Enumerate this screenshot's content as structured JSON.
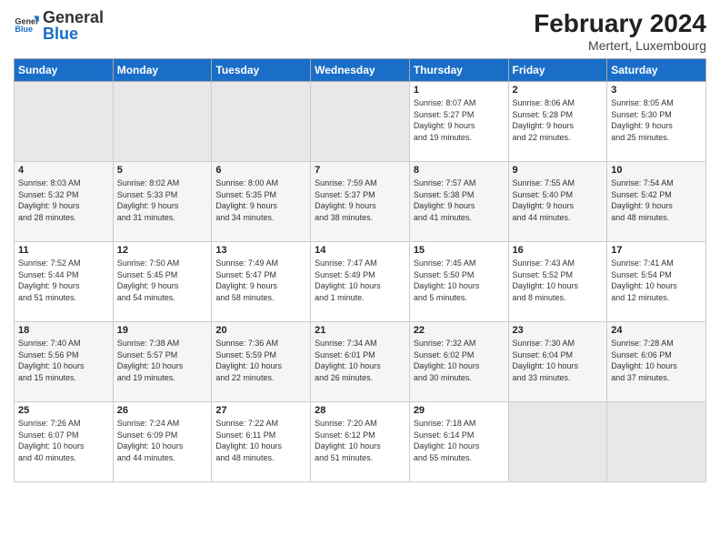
{
  "header": {
    "logo_general": "General",
    "logo_blue": "Blue",
    "title": "February 2024",
    "location": "Mertert, Luxembourg"
  },
  "weekdays": [
    "Sunday",
    "Monday",
    "Tuesday",
    "Wednesday",
    "Thursday",
    "Friday",
    "Saturday"
  ],
  "weeks": [
    [
      {
        "day": "",
        "info": ""
      },
      {
        "day": "",
        "info": ""
      },
      {
        "day": "",
        "info": ""
      },
      {
        "day": "",
        "info": ""
      },
      {
        "day": "1",
        "info": "Sunrise: 8:07 AM\nSunset: 5:27 PM\nDaylight: 9 hours\nand 19 minutes."
      },
      {
        "day": "2",
        "info": "Sunrise: 8:06 AM\nSunset: 5:28 PM\nDaylight: 9 hours\nand 22 minutes."
      },
      {
        "day": "3",
        "info": "Sunrise: 8:05 AM\nSunset: 5:30 PM\nDaylight: 9 hours\nand 25 minutes."
      }
    ],
    [
      {
        "day": "4",
        "info": "Sunrise: 8:03 AM\nSunset: 5:32 PM\nDaylight: 9 hours\nand 28 minutes."
      },
      {
        "day": "5",
        "info": "Sunrise: 8:02 AM\nSunset: 5:33 PM\nDaylight: 9 hours\nand 31 minutes."
      },
      {
        "day": "6",
        "info": "Sunrise: 8:00 AM\nSunset: 5:35 PM\nDaylight: 9 hours\nand 34 minutes."
      },
      {
        "day": "7",
        "info": "Sunrise: 7:59 AM\nSunset: 5:37 PM\nDaylight: 9 hours\nand 38 minutes."
      },
      {
        "day": "8",
        "info": "Sunrise: 7:57 AM\nSunset: 5:38 PM\nDaylight: 9 hours\nand 41 minutes."
      },
      {
        "day": "9",
        "info": "Sunrise: 7:55 AM\nSunset: 5:40 PM\nDaylight: 9 hours\nand 44 minutes."
      },
      {
        "day": "10",
        "info": "Sunrise: 7:54 AM\nSunset: 5:42 PM\nDaylight: 9 hours\nand 48 minutes."
      }
    ],
    [
      {
        "day": "11",
        "info": "Sunrise: 7:52 AM\nSunset: 5:44 PM\nDaylight: 9 hours\nand 51 minutes."
      },
      {
        "day": "12",
        "info": "Sunrise: 7:50 AM\nSunset: 5:45 PM\nDaylight: 9 hours\nand 54 minutes."
      },
      {
        "day": "13",
        "info": "Sunrise: 7:49 AM\nSunset: 5:47 PM\nDaylight: 9 hours\nand 58 minutes."
      },
      {
        "day": "14",
        "info": "Sunrise: 7:47 AM\nSunset: 5:49 PM\nDaylight: 10 hours\nand 1 minute."
      },
      {
        "day": "15",
        "info": "Sunrise: 7:45 AM\nSunset: 5:50 PM\nDaylight: 10 hours\nand 5 minutes."
      },
      {
        "day": "16",
        "info": "Sunrise: 7:43 AM\nSunset: 5:52 PM\nDaylight: 10 hours\nand 8 minutes."
      },
      {
        "day": "17",
        "info": "Sunrise: 7:41 AM\nSunset: 5:54 PM\nDaylight: 10 hours\nand 12 minutes."
      }
    ],
    [
      {
        "day": "18",
        "info": "Sunrise: 7:40 AM\nSunset: 5:56 PM\nDaylight: 10 hours\nand 15 minutes."
      },
      {
        "day": "19",
        "info": "Sunrise: 7:38 AM\nSunset: 5:57 PM\nDaylight: 10 hours\nand 19 minutes."
      },
      {
        "day": "20",
        "info": "Sunrise: 7:36 AM\nSunset: 5:59 PM\nDaylight: 10 hours\nand 22 minutes."
      },
      {
        "day": "21",
        "info": "Sunrise: 7:34 AM\nSunset: 6:01 PM\nDaylight: 10 hours\nand 26 minutes."
      },
      {
        "day": "22",
        "info": "Sunrise: 7:32 AM\nSunset: 6:02 PM\nDaylight: 10 hours\nand 30 minutes."
      },
      {
        "day": "23",
        "info": "Sunrise: 7:30 AM\nSunset: 6:04 PM\nDaylight: 10 hours\nand 33 minutes."
      },
      {
        "day": "24",
        "info": "Sunrise: 7:28 AM\nSunset: 6:06 PM\nDaylight: 10 hours\nand 37 minutes."
      }
    ],
    [
      {
        "day": "25",
        "info": "Sunrise: 7:26 AM\nSunset: 6:07 PM\nDaylight: 10 hours\nand 40 minutes."
      },
      {
        "day": "26",
        "info": "Sunrise: 7:24 AM\nSunset: 6:09 PM\nDaylight: 10 hours\nand 44 minutes."
      },
      {
        "day": "27",
        "info": "Sunrise: 7:22 AM\nSunset: 6:11 PM\nDaylight: 10 hours\nand 48 minutes."
      },
      {
        "day": "28",
        "info": "Sunrise: 7:20 AM\nSunset: 6:12 PM\nDaylight: 10 hours\nand 51 minutes."
      },
      {
        "day": "29",
        "info": "Sunrise: 7:18 AM\nSunset: 6:14 PM\nDaylight: 10 hours\nand 55 minutes."
      },
      {
        "day": "",
        "info": ""
      },
      {
        "day": "",
        "info": ""
      }
    ]
  ]
}
